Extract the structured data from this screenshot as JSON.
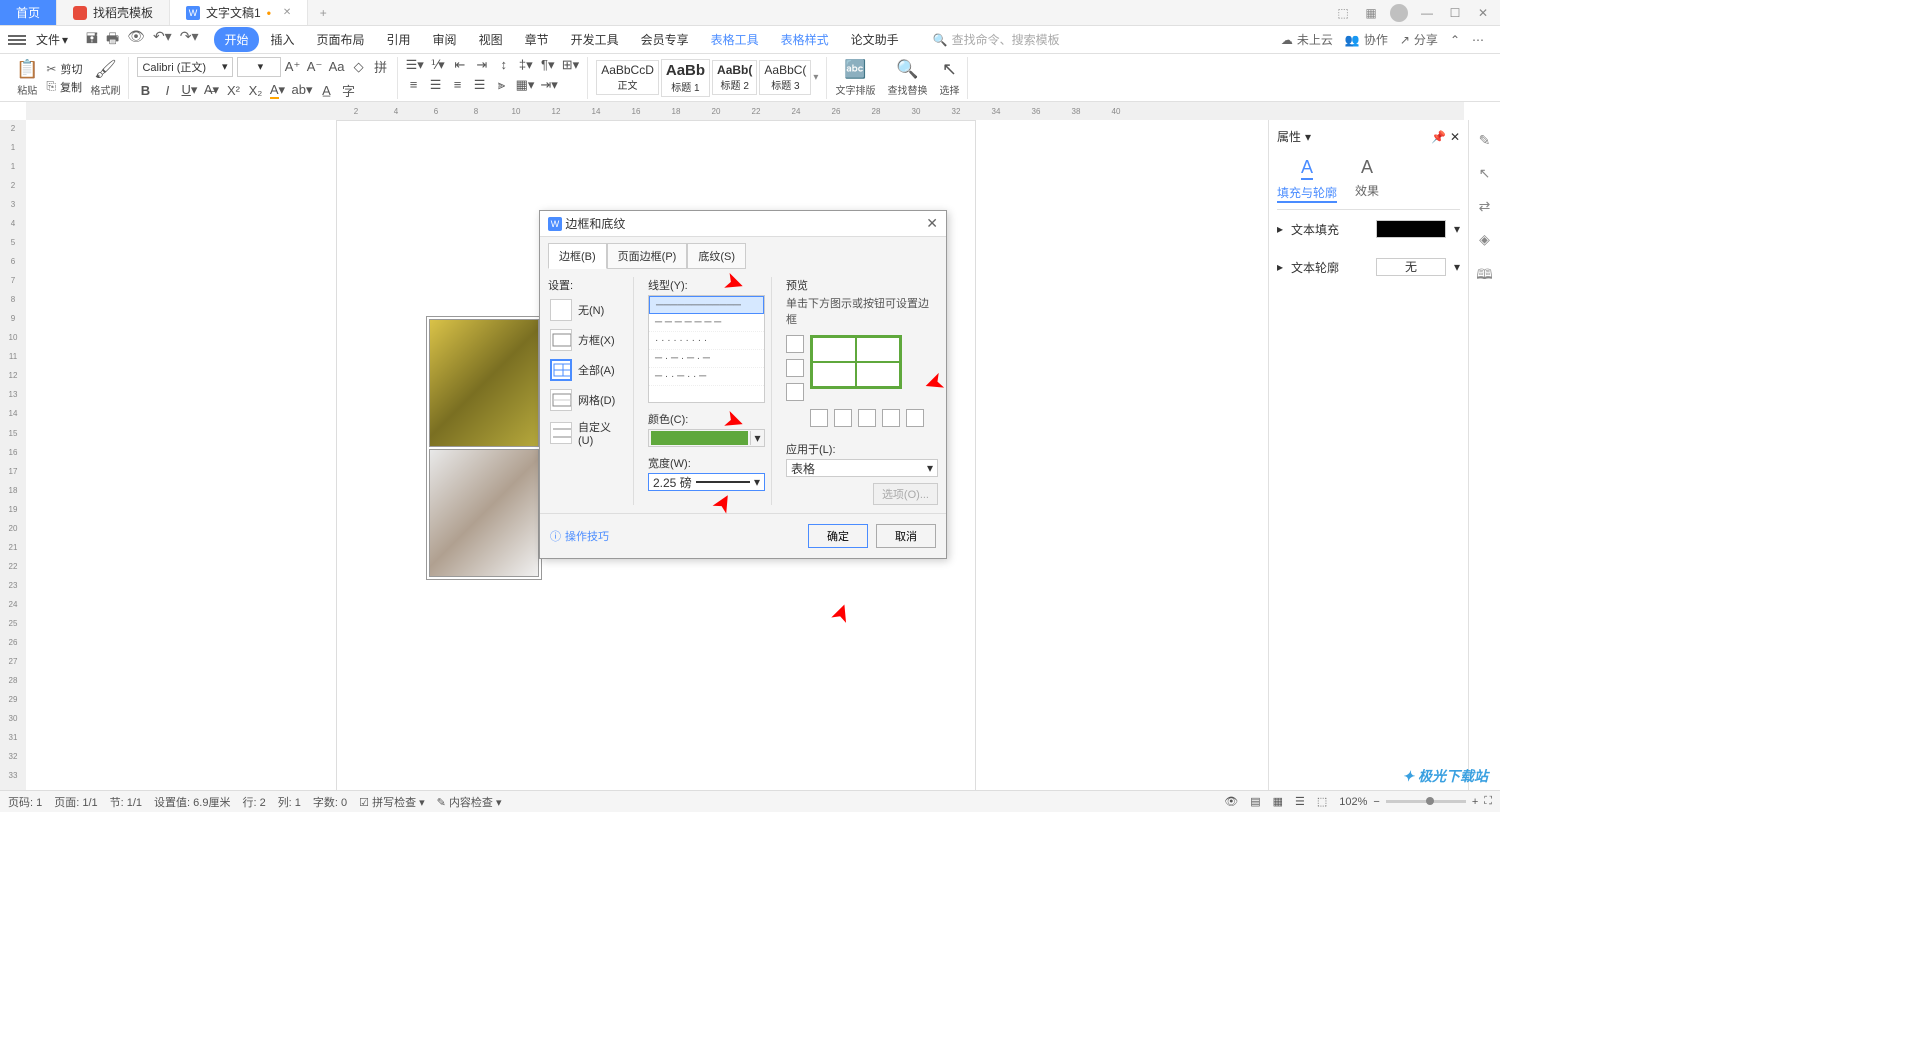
{
  "tabs": {
    "home": "首页",
    "t1": "找稻壳模板",
    "t2": "文字文稿1"
  },
  "menu": {
    "file": "文件",
    "items": [
      "开始",
      "插入",
      "页面布局",
      "引用",
      "审阅",
      "视图",
      "章节",
      "开发工具",
      "会员专享",
      "表格工具",
      "表格样式",
      "论文助手"
    ],
    "search_ph": "查找命令、搜索模板",
    "search_lbl": "查找命令",
    "cloud": "未上云",
    "collab": "协作",
    "share": "分享"
  },
  "ribbon": {
    "paste": "粘贴",
    "cut": "剪切",
    "copy": "复制",
    "fmt": "格式刷",
    "font": "Calibri (正文)",
    "size": "",
    "styles": {
      "body": "正文",
      "h1": "标题 1",
      "h2": "标题 2",
      "h3": "标题 3"
    },
    "style_prev": {
      "body": "AaBbCcD",
      "h1": "AaBb",
      "h2": "AaBb(",
      "h3": "AaBbC("
    },
    "typeset": "文字排版",
    "find": "查找替换",
    "select": "选择"
  },
  "panel": {
    "title": "属性",
    "tab1": "填充与轮廓",
    "tab2": "效果",
    "fill_lbl": "文本填充",
    "outline_lbl": "文本轮廓",
    "outline_val": "无"
  },
  "dialog": {
    "title": "边框和底纹",
    "tabs": [
      "边框(B)",
      "页面边框(P)",
      "底纹(S)"
    ],
    "setting_lbl": "设置:",
    "settings": [
      "无(N)",
      "方框(X)",
      "全部(A)",
      "网格(D)",
      "自定义(U)"
    ],
    "style_lbl": "线型(Y):",
    "color_lbl": "颜色(C):",
    "width_lbl": "宽度(W):",
    "width_val": "2.25 磅",
    "preview_lbl": "预览",
    "preview_hint": "单击下方图示或按钮可设置边框",
    "apply_lbl": "应用于(L):",
    "apply_val": "表格",
    "options": "选项(O)...",
    "tips": "操作技巧",
    "ok": "确定",
    "cancel": "取消"
  },
  "status": {
    "page": "页码: 1",
    "pages": "页面: 1/1",
    "sec": "节: 1/1",
    "pos": "设置值: 6.9厘米",
    "line": "行: 2",
    "col": "列: 1",
    "words": "字数: 0",
    "spell": "拼写检查",
    "content": "内容检查",
    "zoom": "102%"
  },
  "watermark": "极光下载站"
}
